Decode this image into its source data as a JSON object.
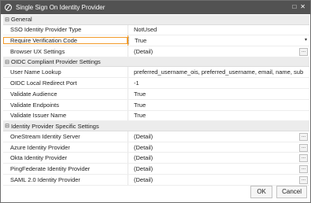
{
  "window": {
    "title": "Single Sign On Identity Provider",
    "restore_glyph": "□",
    "close_glyph": "✕"
  },
  "sections": [
    {
      "label": "General",
      "rows": [
        {
          "name": "SSO Identity Provider Type",
          "value": "NotUsed"
        },
        {
          "name": "Require Verification Code",
          "value": "True",
          "highlight": true,
          "dropdown": true
        },
        {
          "name": "Browser UX Settings",
          "value": "(Detail)",
          "button": true
        }
      ]
    },
    {
      "label": "OIDC Compliant Provider Settings",
      "rows": [
        {
          "name": "User Name Lookup",
          "value": "preferred_username_ois, preferred_username, email, name, sub"
        },
        {
          "name": "OIDC Local Redirect Port",
          "value": "-1"
        },
        {
          "name": "Validate Audience",
          "value": "True"
        },
        {
          "name": "Validate Endpoints",
          "value": "True"
        },
        {
          "name": "Validate Issuer Name",
          "value": "True"
        }
      ]
    },
    {
      "label": "Identity Provider Specific Settings",
      "rows": [
        {
          "name": "OneStream Identity Server",
          "value": "(Detail)",
          "button": true
        },
        {
          "name": "Azure Identity Provider",
          "value": "(Detail)",
          "button": true
        },
        {
          "name": "Okta Identity Provider",
          "value": "(Detail)",
          "button": true
        },
        {
          "name": "PingFederate Identity Provider",
          "value": "(Detail)",
          "button": true
        },
        {
          "name": "SAML 2.0 Identity Provider",
          "value": "(Detail)",
          "button": true
        }
      ]
    }
  ],
  "collapse_glyph": "⊟",
  "detail_button_label": "...",
  "dropdown_glyph": "▾",
  "footer": {
    "ok_label": "OK",
    "cancel_label": "Cancel"
  },
  "colors": {
    "titlebar": "#525252",
    "highlight": "#f29b2b",
    "section_bg": "#ececec"
  }
}
